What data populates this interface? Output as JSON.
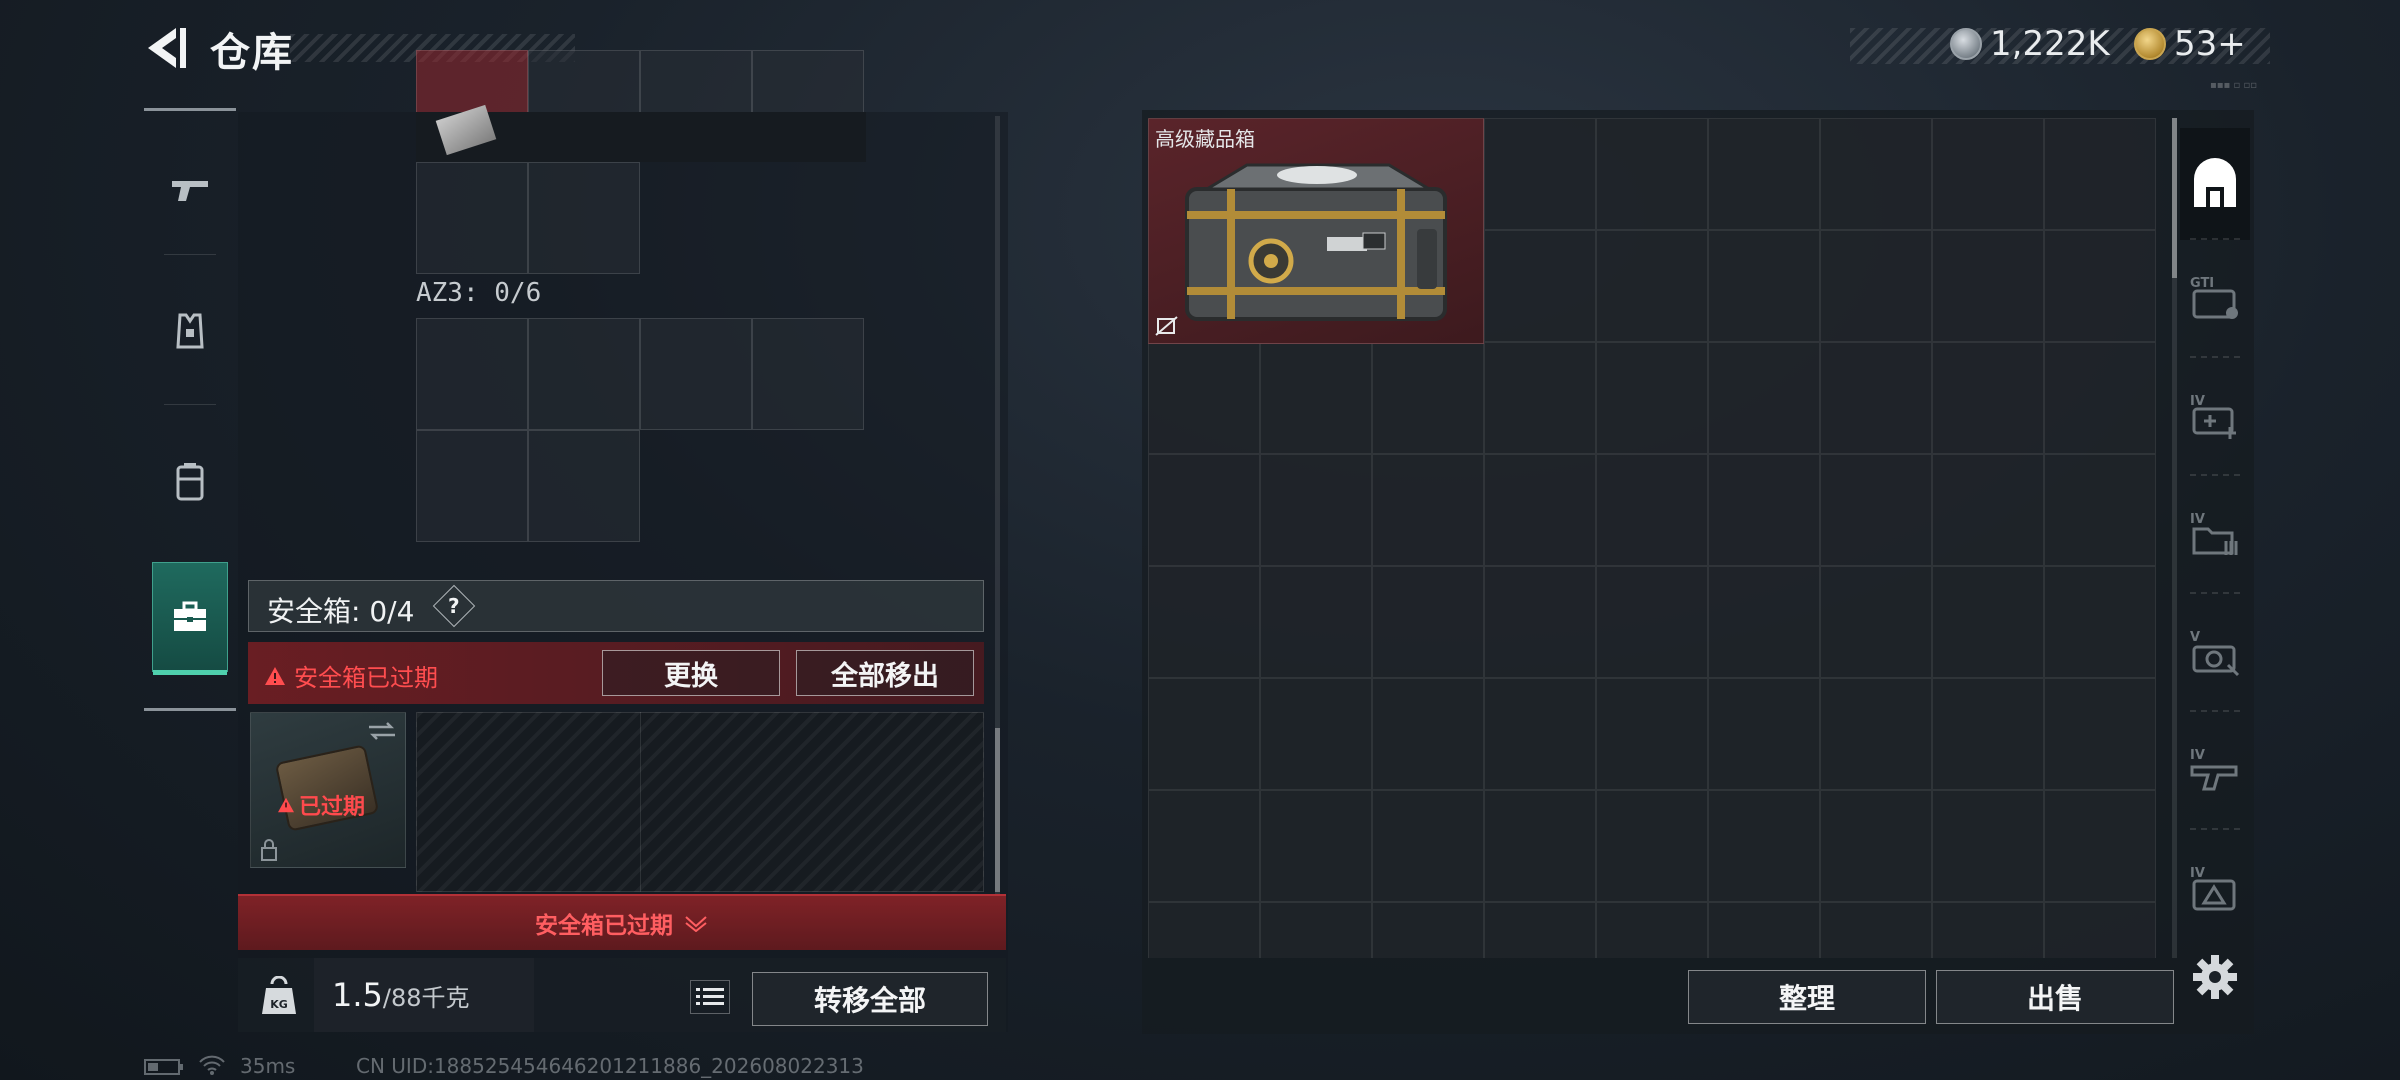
{
  "header": {
    "title": "仓库",
    "currencies": [
      {
        "icon": "silver-coin-icon",
        "value": "1,222K"
      },
      {
        "icon": "gold-coin-icon",
        "value": "53+"
      }
    ]
  },
  "left_tabs": [
    {
      "name": "weapon",
      "icon": "pistol-icon",
      "active": false
    },
    {
      "name": "armor",
      "icon": "armor-vest-icon",
      "active": false
    },
    {
      "name": "backpack",
      "icon": "backpack-icon",
      "active": false
    },
    {
      "name": "secure-case",
      "icon": "briefcase-icon",
      "active": true
    }
  ],
  "left_panel": {
    "az3_label": "AZ3: 0/6",
    "secure_box": {
      "label": "安全箱: 0/4",
      "help": "?",
      "expired_text": "安全箱已过期",
      "replace_button": "更换",
      "remove_all_button": "全部移出",
      "box_badge": "已过期"
    },
    "drawer_text": "安全箱已过期",
    "weight": {
      "value": "1.5",
      "capacity": "/88千克"
    },
    "transfer_all_button": "转移全部"
  },
  "storage": {
    "items": [
      {
        "name": "高级藏品箱",
        "background": "#5a242a"
      }
    ],
    "right_categories": [
      {
        "icon": "all-items-icon",
        "active": true
      },
      {
        "icon": "collectible-icon",
        "active": false
      },
      {
        "icon": "medical-icon",
        "active": false
      },
      {
        "icon": "ammo-icon",
        "active": false
      },
      {
        "icon": "camera-icon",
        "active": false
      },
      {
        "icon": "weapon-part-icon",
        "active": false
      },
      {
        "icon": "misc-icon",
        "active": false
      }
    ],
    "organize_button": "整理",
    "sell_button": "出售"
  },
  "status_bar": {
    "ping": "35ms",
    "uid": "CN UID:188525454646201211886_202608022313"
  },
  "colors": {
    "accent_teal": "#4fd0ad",
    "expired_red": "#ff4d4f",
    "item_bg_red": "#5a242a"
  }
}
